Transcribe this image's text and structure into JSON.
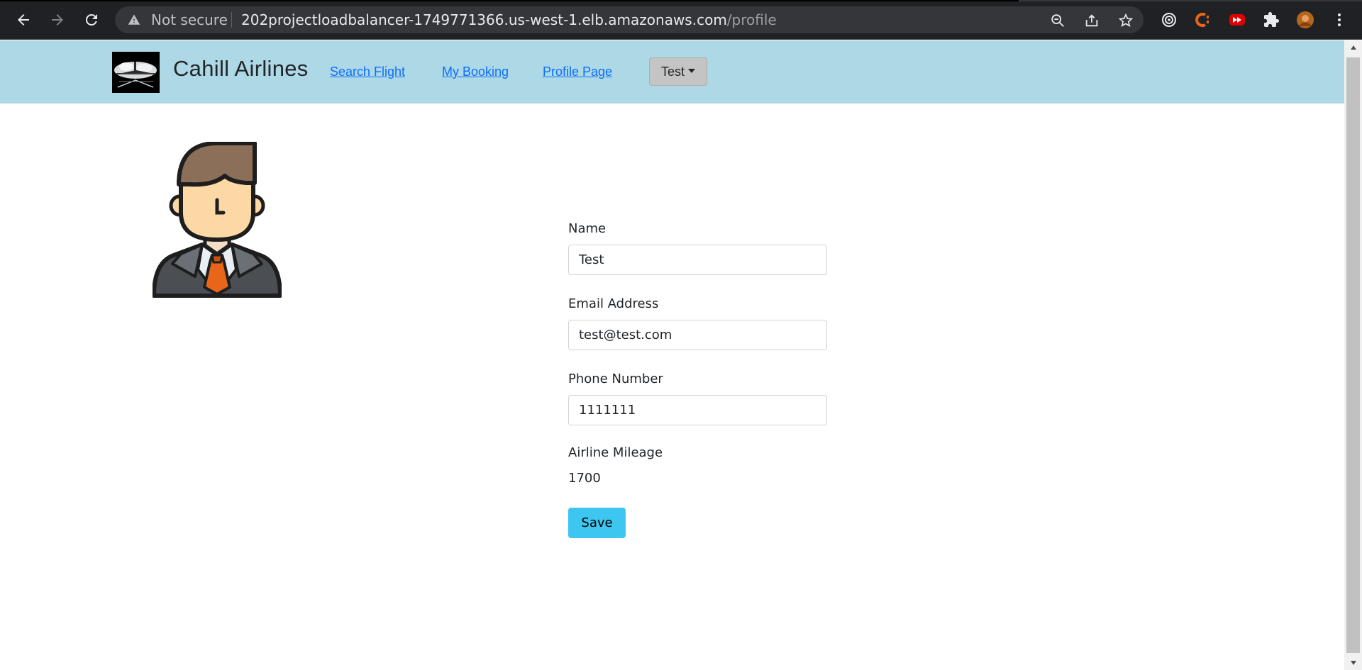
{
  "browser": {
    "security_label": "Not secure",
    "url_host": "202projectloadbalancer-1749771366.us-west-1.elb.amazonaws.com",
    "url_path": "/profile"
  },
  "site": {
    "brand": "Cahill Airlines",
    "nav": [
      {
        "label": "Search Flight"
      },
      {
        "label": "My Booking"
      },
      {
        "label": "Profile Page"
      }
    ],
    "user_menu_label": "Test"
  },
  "profile": {
    "name_label": "Name",
    "name_value": "Test",
    "email_label": "Email Address",
    "email_value": "test@test.com",
    "phone_label": "Phone Number",
    "phone_value": "1111111",
    "mileage_label": "Airline Mileage",
    "mileage_value": "1700",
    "save_label": "Save"
  },
  "colors": {
    "header_bg": "#add8e6",
    "link": "#0d6efd",
    "save_button": "#3dc7f0",
    "tie": "#e8661a"
  }
}
